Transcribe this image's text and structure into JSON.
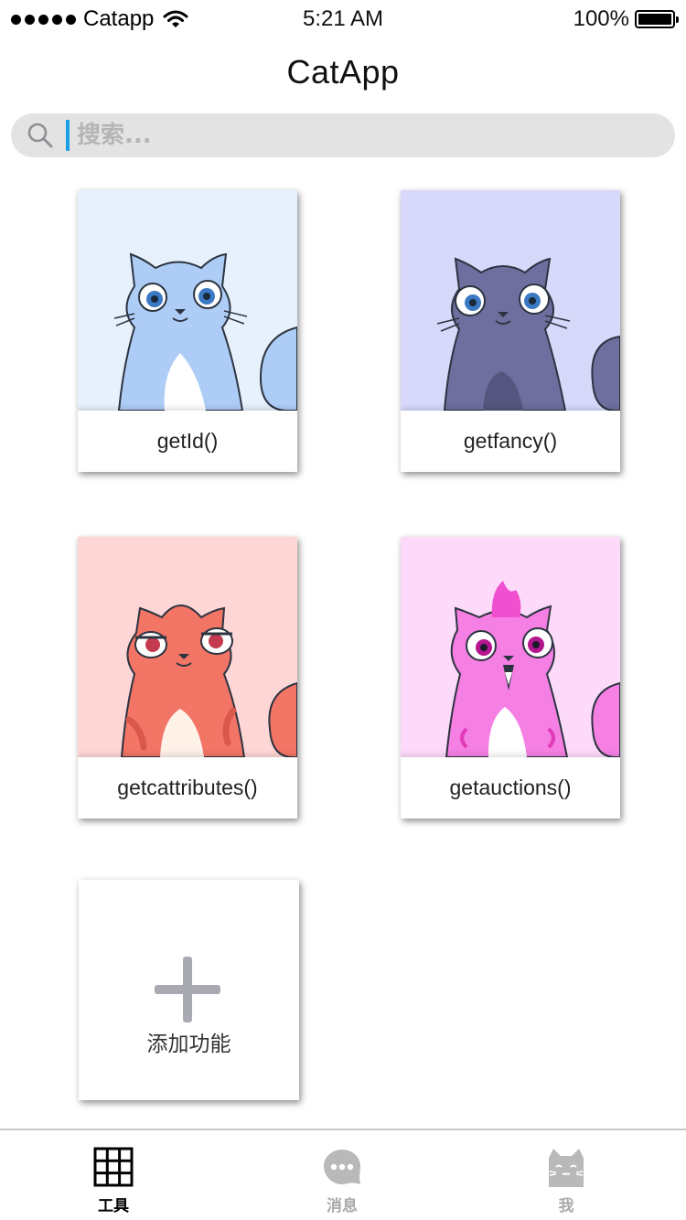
{
  "status_bar": {
    "carrier": "Catapp",
    "time": "5:21 AM",
    "battery": "100%"
  },
  "app": {
    "title": "CatApp"
  },
  "search": {
    "placeholder": "搜索..."
  },
  "cards": [
    {
      "label": "getId()",
      "bg": "#e6f1fc",
      "fur": "#aecdf6",
      "eye": "#3b79c4"
    },
    {
      "label": "getfancy()",
      "bg": "#d8d8fb",
      "fur": "#6e6f9f",
      "eye": "#3b79c4"
    },
    {
      "label": "getcattributes()",
      "bg": "#fed6d6",
      "fur": "#f27566",
      "eye": "#c43b4f"
    },
    {
      "label": "getauctions()",
      "bg": "#fddaf9",
      "fur": "#f57fe3",
      "eye": "#b5168f"
    }
  ],
  "add_card": {
    "label": "添加功能"
  },
  "tab_bar": {
    "tabs": [
      {
        "label": "工具",
        "icon": "grid-icon",
        "active": true
      },
      {
        "label": "消息",
        "icon": "chat-bubble-icon",
        "active": false
      },
      {
        "label": "我",
        "icon": "cat-face-icon",
        "active": false
      }
    ]
  },
  "colors": {
    "accent_cursor": "#1aa0e6",
    "search_bg": "#e3e3e3",
    "inactive": "#a9a9a9"
  }
}
